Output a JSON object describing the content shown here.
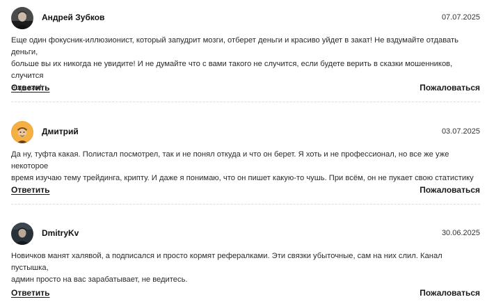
{
  "comments": [
    {
      "author": "Андрей Зубков",
      "date": "07.07.2025",
      "text": "Еще один фокусник-иллюзионист, который запудрит мозги, отберет деньги и красиво уйдет в закат! Не вздумайте отдавать деньги,\nбольше вы их никогда не увидите! И не думайте что с вами такого не случится, если будете верить в сказки мошенников, случится\nеще как!",
      "reply_label": "Ответить",
      "report_label": "Пожаловаться"
    },
    {
      "author": "Дмитрий",
      "date": "03.07.2025",
      "text": "Да ну, туфта какая. Полистал посмотрел, так и не понял откуда и что он берет. Я хоть и не профессионал, но все же уже некоторое\nвремя изучаю тему трейдинга, крипту. И даже я понимаю, что он пишет какую-то чушь. При всём, он не пукает свою статистику",
      "reply_label": "Ответить",
      "report_label": "Пожаловаться"
    },
    {
      "author": "DmitryKv",
      "date": "30.06.2025",
      "text": "Новичков манят халявой, а подписался и просто кормят рефералками. Эти связки убыточные, сам на них слил. Канал пустышка,\nадмин просто на вас зарабатывает, не ведитесь.",
      "reply_label": "Ответить",
      "report_label": "Пожаловаться"
    }
  ],
  "colors": {
    "text": "#1f1f1f",
    "divider": "#dcdcdc",
    "background": "#ffffff"
  }
}
